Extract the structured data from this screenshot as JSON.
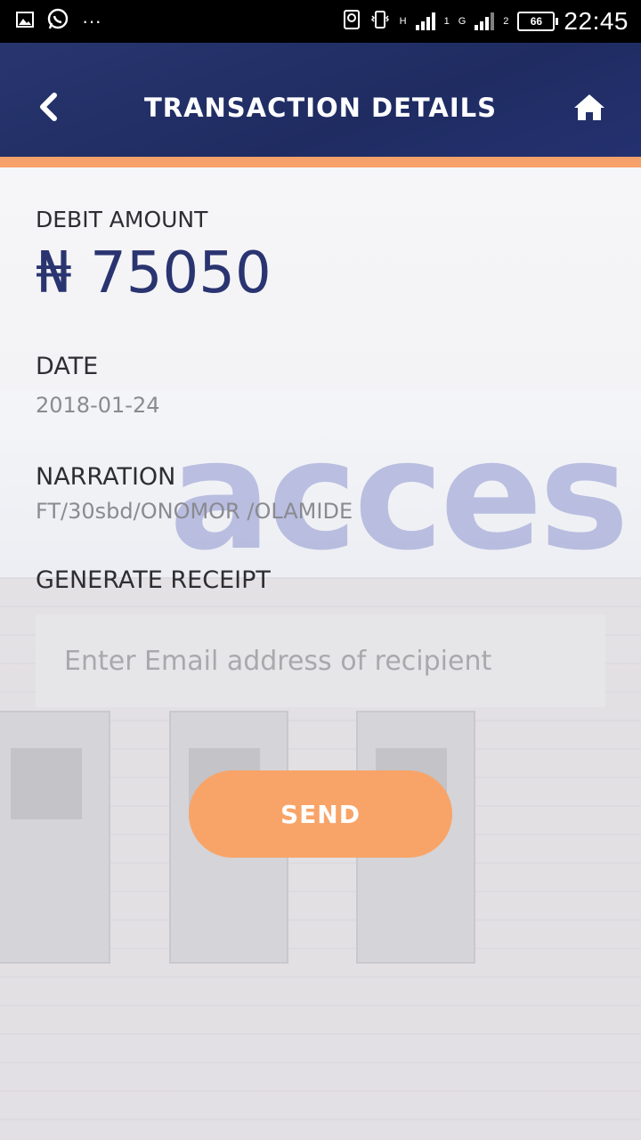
{
  "status_bar": {
    "time": "22:45",
    "battery": "66",
    "network_1": "H",
    "network_2": "G",
    "sim_1": "1",
    "sim_2": "2",
    "overflow": "···"
  },
  "header": {
    "title": "TRANSACTION DETAILS",
    "back_icon": "chevron-left-icon",
    "home_icon": "home-icon"
  },
  "debit": {
    "label": "DEBIT  AMOUNT",
    "amount": "₦ 75050"
  },
  "date": {
    "label": "DATE",
    "value": "2018-01-24"
  },
  "narration": {
    "label": "NARRATION",
    "value": "FT/30sbd/ONOMOR /OLAMIDE"
  },
  "receipt": {
    "label": "GENERATE RECEIPT",
    "email_placeholder": "Enter Email address of recipient",
    "email_value": "",
    "send_label": "SEND"
  },
  "background": {
    "sign_text": "acces"
  },
  "colors": {
    "header": "#1f2c62",
    "accent": "#f8a468",
    "amount": "#2a3470"
  }
}
